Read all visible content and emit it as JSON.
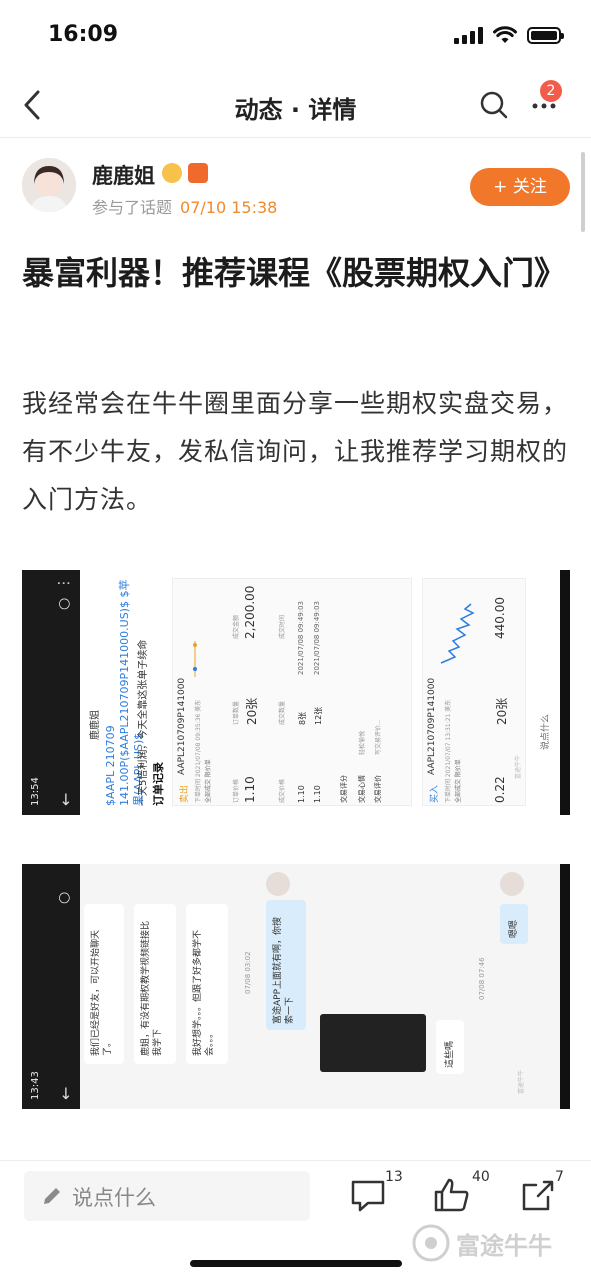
{
  "status": {
    "time": "16:09"
  },
  "nav": {
    "title": "动态 · 详情",
    "badge": "2"
  },
  "author": {
    "name": "鹿鹿姐",
    "meta_prefix": "参与了话题",
    "time": "07/10 15:38",
    "follow_label": "+ 关注"
  },
  "article": {
    "title": "暴富利器！推荐课程《股票期权入门》",
    "body": "我经常会在牛牛圈里面分享一些期权实盘交易，有不少牛友，发私信询问，让我推荐学习期权的入门方法。"
  },
  "shot1": {
    "phone_time": "13:54",
    "user": "鹿鹿姐",
    "link": "$AAPL 210709 141.00P($AAPL210709P141000.US)$ $苹果(AAPL.US)$",
    "desc": "一天5倍利润，今天全靠这张单子续命",
    "order_title": "订单记录",
    "sell_tag": "卖出",
    "sell_code": "AAPL210709P141000",
    "sell_sub": "下单时间 2021/07/08 09:35:36 美东",
    "sell_type": "全部成交   限价单",
    "price_label": "订单价格",
    "qty_label": "订单数量",
    "amount_label": "成交金额",
    "sell_price": "1.10",
    "sell_qty": "20张",
    "sell_amount": "2,200.00",
    "fill_price_label": "成交价格",
    "fill_qty_label": "成交数量",
    "fill_time_label": "成交时间",
    "fill1_price": "1.10",
    "fill1_qty": "8张",
    "fill1_time": "2021/07/08 09:49:03",
    "fill2_price": "1.10",
    "fill2_qty": "12张",
    "fill2_time": "2021/07/08 09:49:03",
    "rating_label": "交易评分",
    "mood_label": "交易心情",
    "review_label": "交易评价",
    "mood_btn": "轻松愉悦",
    "review_btn": "写交易评价...",
    "buy_tag": "买入",
    "buy_code": "AAPL210709P141000",
    "buy_sub": "下单时间 2021/07/07 13:31:21 美东",
    "buy_type": "全部成交   限价单",
    "buy_price": "0.22",
    "buy_qty": "20张",
    "buy_amount": "440.00",
    "say_something": "说点什么",
    "watermark": "富途牛牛"
  },
  "shot2": {
    "phone_time": "13:43",
    "msg1": "我们已经是好友，可以开始聊天了。",
    "msg2": "鹿姐，有没有期权教学视频链接比我学下",
    "msg3": "我好想学。。。但跟了好多都学不会。。。",
    "time1": "07/08 03:02",
    "msg4": "富途APP上面就有啊，你搜索一下",
    "msg5": "這些嗎",
    "time2": "07/08 07:46",
    "msg6": "嗯嗯",
    "watermark": "富途牛牛"
  },
  "bottom": {
    "placeholder": "说点什么",
    "comment_count": "13",
    "like_count": "40",
    "share_count": "7"
  },
  "watermark": "富途牛牛"
}
